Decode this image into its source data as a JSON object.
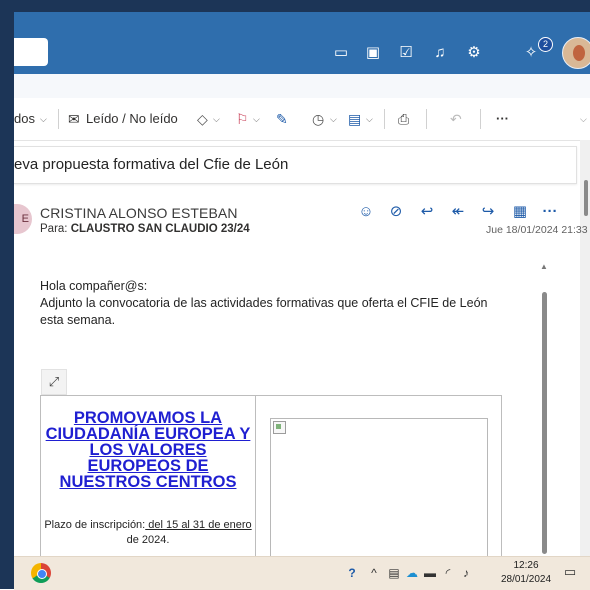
{
  "toolbar": {
    "partial_label": "dos",
    "read_unread_label": "Leído / No leído",
    "more_label": "···"
  },
  "subject": "eva propuesta formativa del Cfie de León",
  "header": {
    "notification_count": "2"
  },
  "message": {
    "sender_initial": "E",
    "sender_name": "CRISTINA ALONSO ESTEBAN",
    "to_label": "Para:",
    "to_value": "CLAUSTRO SAN CLAUDIO 23/24",
    "date": "Jue 18/01/2024 21:33",
    "body": {
      "greeting": "Hola compañer@s:",
      "line1": "Adjunto la convocatoria de las actividades formativas que oferta el CFIE de León",
      "line2": "esta semana."
    },
    "embed": {
      "promo_title": "PROMOVAMOS LA CIUDADANÍA EUROPEA Y LOS VALORES EUROPEOS DE NUESTROS CENTROS",
      "plazo_prefix": "Plazo de inscripción:",
      "plazo_dates": " del 15 al 31 de enero",
      "plazo_suffix": " de 2024."
    }
  },
  "taskbar": {
    "time": "12:26",
    "date": "28/01/2024"
  },
  "colors": {
    "header_blue": "#2f6ead",
    "left_bar": "#1c3557",
    "link_blue": "#1f1fd1",
    "taskbar": "#f1e8dc",
    "flag_red": "#c4314b"
  }
}
